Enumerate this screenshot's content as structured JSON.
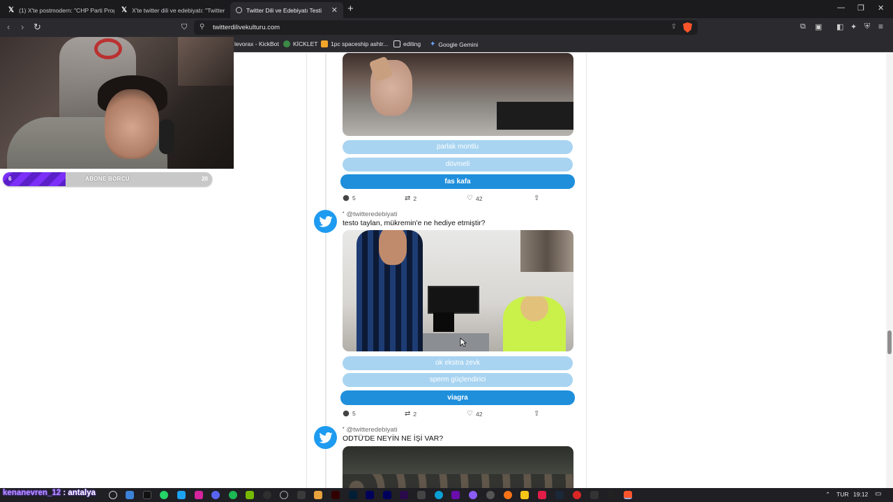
{
  "browser": {
    "tabs": [
      {
        "title": "(1) X'te postmodern: \"CHP Parti Prog",
        "active": false
      },
      {
        "title": "X'te twitter dili ve edebiyatı: \"Twitter",
        "active": false
      },
      {
        "title": "Twitter Dili ve Edebiyatı Testi",
        "active": true
      }
    ],
    "url": "twitterdilivekulturu.com",
    "bookmarks": [
      {
        "label": "levorax - KickBot",
        "icon": "none"
      },
      {
        "label": "KİCKLET",
        "icon": "kicklet-icon"
      },
      {
        "label": "1pc spaceship ashtr...",
        "icon": "shop-icon"
      },
      {
        "label": "editing",
        "icon": "folder-icon"
      },
      {
        "label": "Google Gemini",
        "icon": "gemini-icon"
      }
    ]
  },
  "overlay": {
    "subgoal_current": "6",
    "subgoal_label": "ABONE BORCU",
    "subgoal_target": "20",
    "subgoal_progress": 0.3,
    "chat_user": "kenanevren_12",
    "chat_message": ": antalya"
  },
  "feed": {
    "post1": {
      "options": [
        "parlak montlu",
        "dövmeli",
        "fas kafa"
      ],
      "replies": "5",
      "retweets": "2",
      "likes": "42"
    },
    "post2": {
      "handle": "@twitteredebiyati",
      "text": "testo taylan, mükremin'e ne hediye etmiştir?",
      "options": [
        "ok ekstra zevk",
        "sperm güçlendirici",
        "viagra"
      ],
      "replies": "5",
      "retweets": "2",
      "likes": "42"
    },
    "post3": {
      "handle": "@twitteredebiyati",
      "text": "ODTÜ'DE NEYİN NE İŞİ VAR?"
    }
  },
  "taskbar": {
    "language": "TUR",
    "time": "19:12"
  },
  "colors": {
    "primary_option": "#1f8fdc",
    "secondary_option": "#a8d4f1",
    "twitter_blue": "#1d9bf0",
    "browser_bg": "#2b2b2f",
    "subgoal_fill": "#7b2ff7"
  }
}
